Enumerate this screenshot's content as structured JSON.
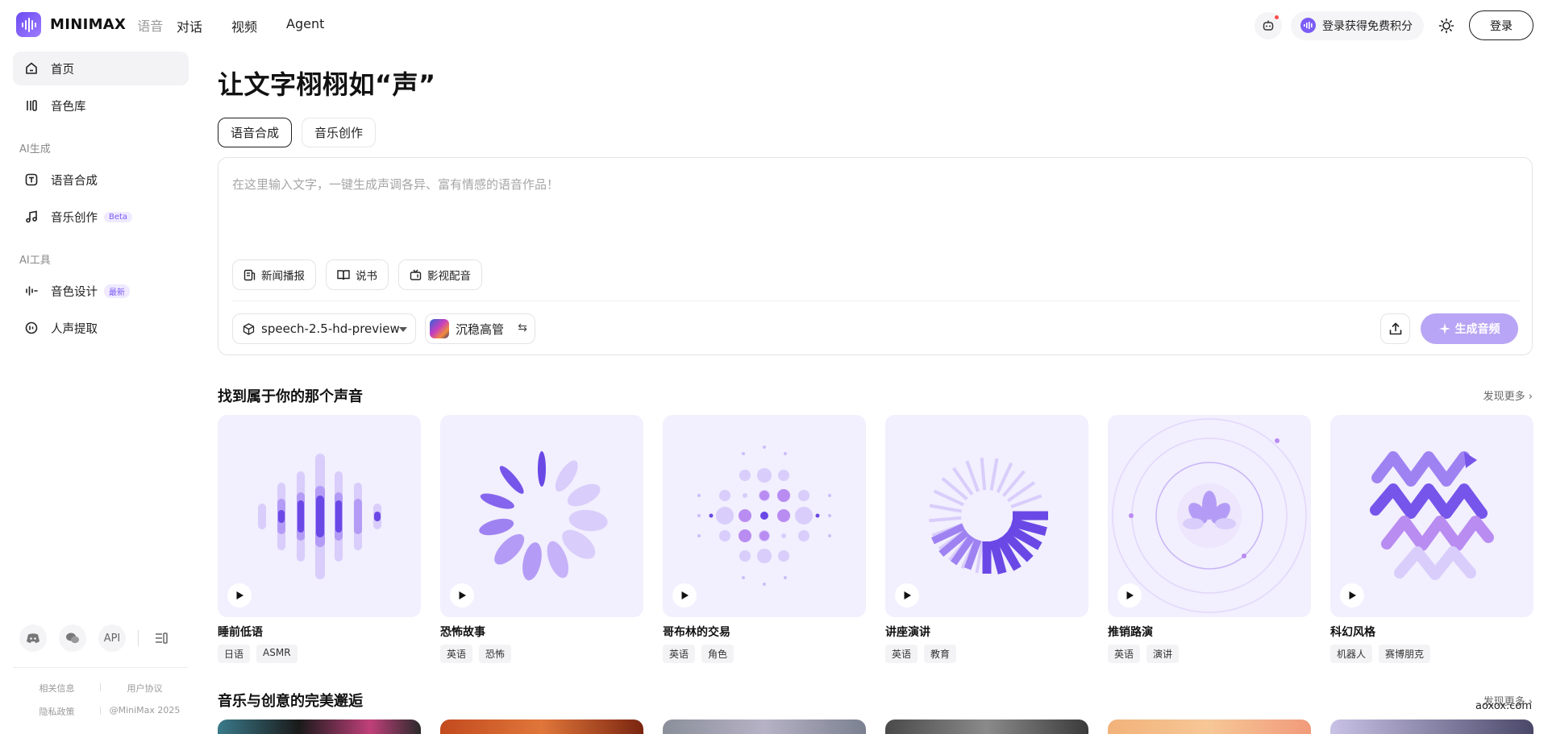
{
  "header": {
    "brand": "MINIMAX",
    "product": "语音",
    "nav": [
      "对话",
      "视频",
      "Agent"
    ],
    "promo": "登录获得免费积分",
    "login": "登录"
  },
  "sidebar": {
    "home": "首页",
    "voice_library": "音色库",
    "section_ai_gen": "AI生成",
    "speech_synthesis": "语音合成",
    "music_creation": "音乐创作",
    "music_badge": "Beta",
    "section_ai_tools": "AI工具",
    "voice_design": "音色设计",
    "voice_design_badge": "最新",
    "voice_extract": "人声提取",
    "api_label": "API",
    "footer": {
      "related_info": "相关信息",
      "user_agreement": "用户协议",
      "privacy": "隐私政策",
      "copyright": "@MiniMax 2025"
    }
  },
  "main": {
    "title": "让文字栩栩如“声”",
    "tabs": [
      "语音合成",
      "音乐创作"
    ],
    "editor": {
      "placeholder": "在这里输入文字，一键生成声调各异、富有情感的语音作品！",
      "chips": [
        "新闻播报",
        "说书",
        "影视配音"
      ],
      "model": "speech-2.5-hd-preview",
      "voice": "沉稳高管",
      "generate": "生成音频"
    },
    "section1": {
      "title": "找到属于你的那个声音",
      "more": "发现更多 ›",
      "cards": [
        {
          "title": "睡前低语",
          "tags": [
            "日语",
            "ASMR"
          ]
        },
        {
          "title": "恐怖故事",
          "tags": [
            "英语",
            "恐怖"
          ]
        },
        {
          "title": "哥布林的交易",
          "tags": [
            "英语",
            "角色"
          ]
        },
        {
          "title": "讲座演讲",
          "tags": [
            "英语",
            "教育"
          ]
        },
        {
          "title": "推销路演",
          "tags": [
            "英语",
            "演讲"
          ]
        },
        {
          "title": "科幻风格",
          "tags": [
            "机器人",
            "赛博朋克"
          ]
        }
      ]
    },
    "section2": {
      "title": "音乐与创意的完美邂逅",
      "more": "发现更多 ›"
    }
  },
  "watermark": "aoxox.com",
  "colors": {
    "accent": "#7b5cf5",
    "generate_button": "#b9a5f5",
    "card_bg": "#f2effe"
  }
}
